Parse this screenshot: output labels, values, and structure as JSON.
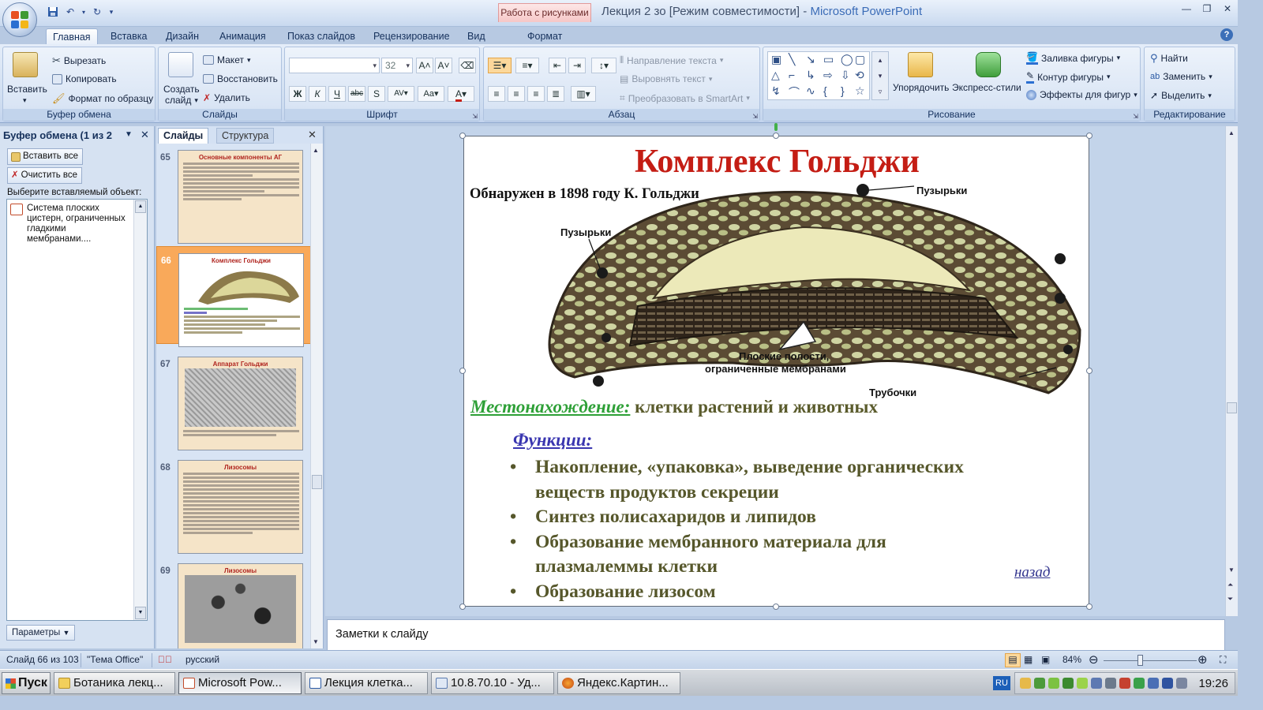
{
  "window": {
    "context_tab": "Работа с рисунками",
    "title_doc": "Лекция 2 зо [Режим совместимости]",
    "title_sep": " - ",
    "title_app": "Microsoft PowerPoint"
  },
  "ribbon_tabs": [
    "Главная",
    "Вставка",
    "Дизайн",
    "Анимация",
    "Показ слайдов",
    "Рецензирование",
    "Вид",
    "Формат"
  ],
  "groups": {
    "clipboard": {
      "label": "Буфер обмена",
      "paste": "Вставить",
      "cut": "Вырезать",
      "copy": "Копировать",
      "format_painter": "Формат по образцу"
    },
    "slides": {
      "label": "Слайды",
      "new_slide_1": "Создать",
      "new_slide_2": "слайд",
      "layout": "Макет",
      "reset": "Восстановить",
      "delete": "Удалить"
    },
    "font": {
      "label": "Шрифт",
      "size": "32"
    },
    "paragraph": {
      "label": "Абзац",
      "text_direction": "Направление текста",
      "align_text": "Выровнять текст",
      "smartart": "Преобразовать в SmartArt"
    },
    "drawing": {
      "label": "Рисование",
      "arrange": "Упорядочить",
      "quick_styles": "Экспресс-стили",
      "shape_fill": "Заливка фигуры",
      "shape_outline": "Контур фигуры",
      "shape_effects": "Эффекты для фигур"
    },
    "editing": {
      "label": "Редактирование",
      "find": "Найти",
      "replace": "Заменить",
      "select": "Выделить"
    }
  },
  "clipboard_pane": {
    "title": "Буфер обмена (1 из 2",
    "paste_all": "Вставить все",
    "clear_all": "Очистить все",
    "prompt": "Выберите вставляемый объект:",
    "item_text": "Система плоских цистерн, ограниченных гладкими мембранами....",
    "options": "Параметры"
  },
  "slides_panel": {
    "tab_slides": "Слайды",
    "tab_outline": "Структура",
    "thumbnails": [
      {
        "number": "65",
        "title": "Основные компоненты АГ"
      },
      {
        "number": "66",
        "title": "Комплекс Гольджи",
        "selected": true
      },
      {
        "number": "67",
        "title": "Аппарат Гольджи"
      },
      {
        "number": "68",
        "title": "Лизосомы"
      },
      {
        "number": "69",
        "title": "Лизосомы"
      }
    ]
  },
  "slide": {
    "title": "Комплекс Гольджи",
    "subtitle": "Обнаружен в 1898 году К. Гольджи",
    "callouts": {
      "vesicles_top": "Пузырьки",
      "vesicles_left": "Пузырьки",
      "flat_cavities_1": "Плоские полости,",
      "flat_cavities_2": "ограниченные мембранами",
      "tubules": "Трубочки"
    },
    "location_label": "Местонахождение:",
    "location_text": " клетки растений и животных",
    "functions_title": "Функции:",
    "functions": [
      "Накопление, «упаковка», выведение органических веществ продуктов секреции",
      "Синтез полисахаридов и липидов",
      "Образование мембранного материала для плазмалеммы клетки",
      "Образование лизосом"
    ],
    "back_link": "назад"
  },
  "notes_placeholder": "Заметки к слайду",
  "status": {
    "slide_counter": "Слайд 66 из 103",
    "theme": "\"Тема Office\"",
    "language": "русский",
    "zoom": "84%"
  },
  "taskbar": {
    "start": "Пуск",
    "tasks": [
      "Ботаника лекц...",
      "Microsoft Pow...",
      "Лекция клетка...",
      "10.8.70.10 - Уд...",
      "Яндекс.Картин..."
    ],
    "lang_indicator": "RU",
    "clock": "19:26"
  },
  "colors": {
    "title_red": "#c41d14",
    "location_green": "#2ea037",
    "functions_blue": "#3a36b0",
    "body_olive": "#56572b",
    "selected_thumb": "#f9a95a"
  }
}
